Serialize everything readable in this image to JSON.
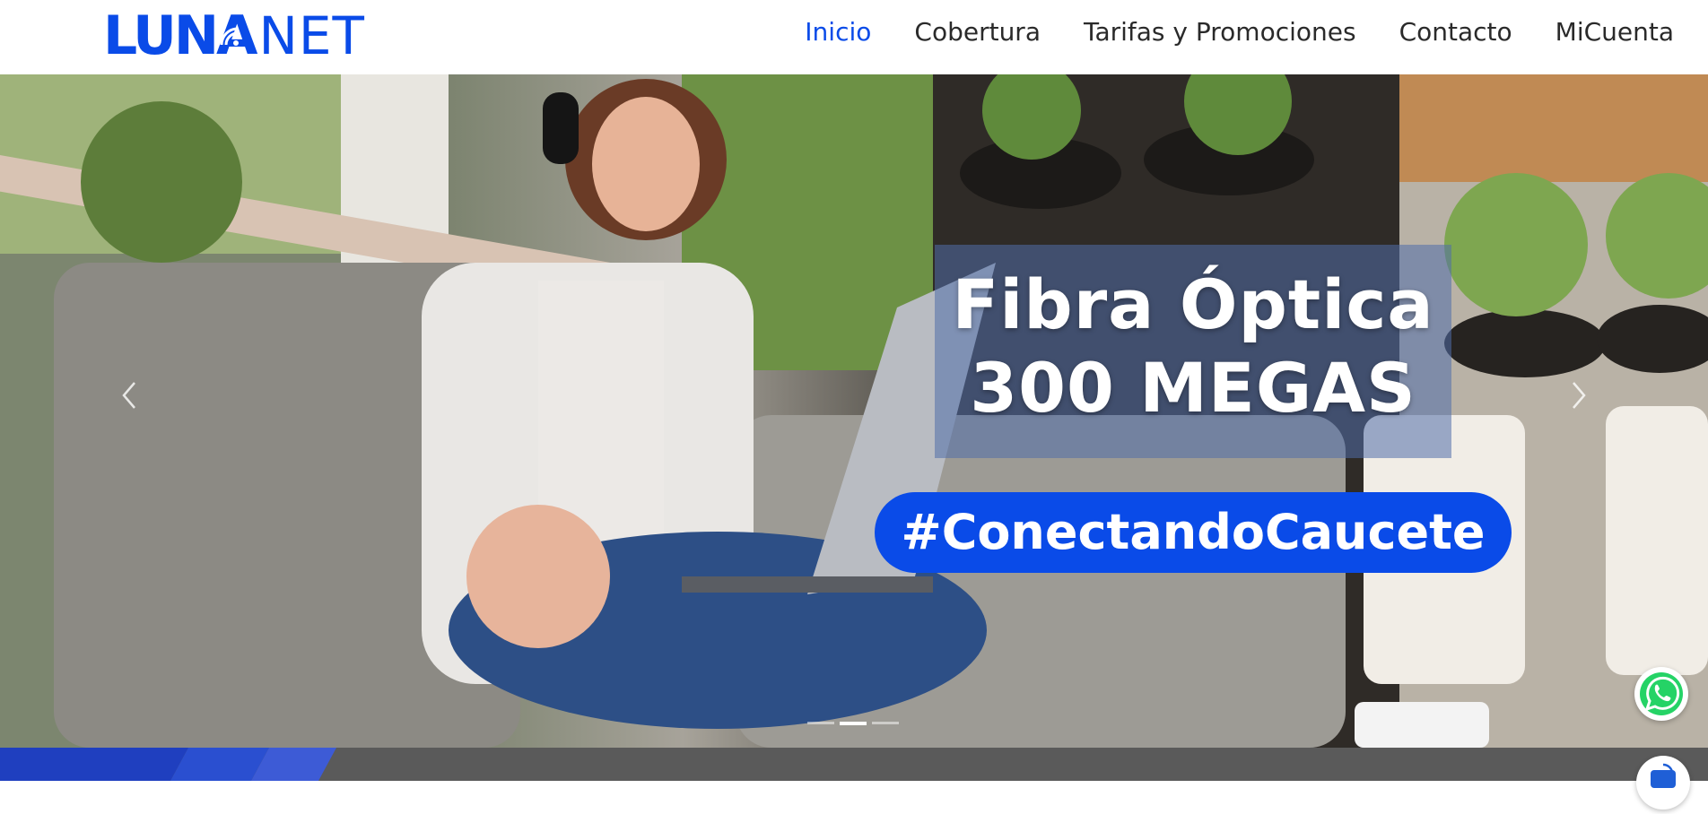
{
  "brand": {
    "logo_primary": "LUNA",
    "logo_secondary": "NET",
    "color": "#0a4be8"
  },
  "nav": {
    "items": [
      {
        "label": "Inicio",
        "active": true
      },
      {
        "label": "Cobertura",
        "active": false
      },
      {
        "label": "Tarifas y Promociones",
        "active": false
      },
      {
        "label": "Contacto",
        "active": false
      },
      {
        "label": "MiCuenta",
        "active": false
      }
    ]
  },
  "hero": {
    "headline_line1": "Fibra Óptica",
    "headline_line2": "300 MEGAS",
    "hashtag": "#ConectandoCaucete",
    "slides_total": 3,
    "active_slide": 2,
    "prev_icon": "chevron-left-icon",
    "next_icon": "chevron-right-icon"
  },
  "floating": {
    "whatsapp_icon": "whatsapp-icon",
    "chat_icon": "chat-icon"
  },
  "colors": {
    "accent": "#0a4be8",
    "whatsapp": "#25d366",
    "band": "#5a5a5a"
  }
}
